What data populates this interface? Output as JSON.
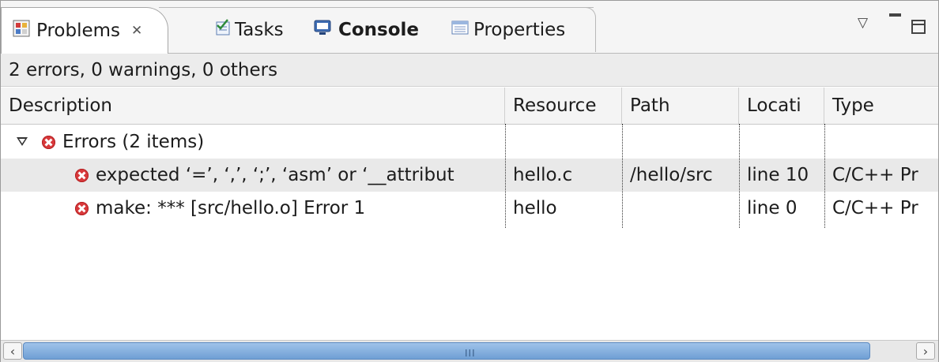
{
  "tabs": {
    "problems": "Problems",
    "tasks": "Tasks",
    "console": "Console",
    "properties": "Properties"
  },
  "summary": "2 errors, 0 warnings, 0 others",
  "columns": {
    "description": "Description",
    "resource": "Resource",
    "path": "Path",
    "location": "Locati",
    "type": "Type"
  },
  "group": {
    "label": "Errors (2 items)",
    "expanded": true
  },
  "rows": [
    {
      "description": "expected ‘=’, ‘,’, ‘;’, ‘asm’ or ‘__attribut",
      "resource": "hello.c",
      "path": "/hello/src",
      "location": "line 10",
      "type": "C/C++ Pr",
      "selected": true
    },
    {
      "description": "make: *** [src/hello.o] Error 1",
      "resource": "hello",
      "path": "",
      "location": "line 0",
      "type": "C/C++ Pr",
      "selected": false
    }
  ],
  "scrollbar": {
    "grip": "III"
  },
  "colors": {
    "error": "#d8393b",
    "selection": "#e9e9e9",
    "scroll_thumb": "#7ea9db"
  }
}
